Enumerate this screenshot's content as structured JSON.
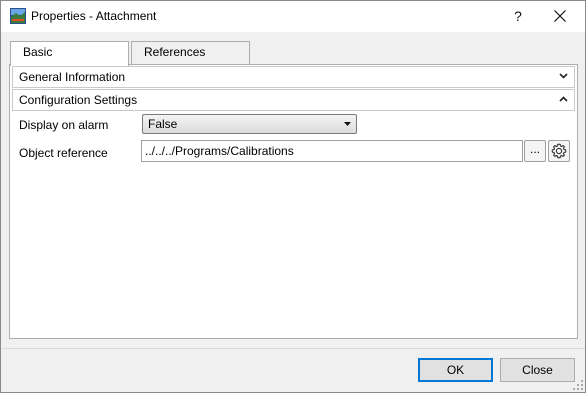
{
  "window": {
    "title": "Properties - Attachment",
    "help_glyph": "?",
    "icons": {
      "app": "app-icon",
      "close": "close-icon"
    }
  },
  "tabs": [
    {
      "label": "Basic",
      "active": true
    },
    {
      "label": "References",
      "active": false
    }
  ],
  "sections": [
    {
      "label": "General Information",
      "expanded": false,
      "icon": "chevron-down-icon"
    },
    {
      "label": "Configuration Settings",
      "expanded": true,
      "icon": "chevron-up-icon"
    }
  ],
  "fields": {
    "display_on_alarm": {
      "label": "Display on alarm",
      "selected_value": "False"
    },
    "object_reference": {
      "label": "Object reference",
      "value": "../../../Programs/Calibrations",
      "browse_label": "...",
      "settings_icon": "gear-icon"
    }
  },
  "buttons": {
    "ok": "OK",
    "close": "Close"
  },
  "colors": {
    "default_button_border": "#0078d7",
    "dialog_background": "#f0f0f0"
  }
}
